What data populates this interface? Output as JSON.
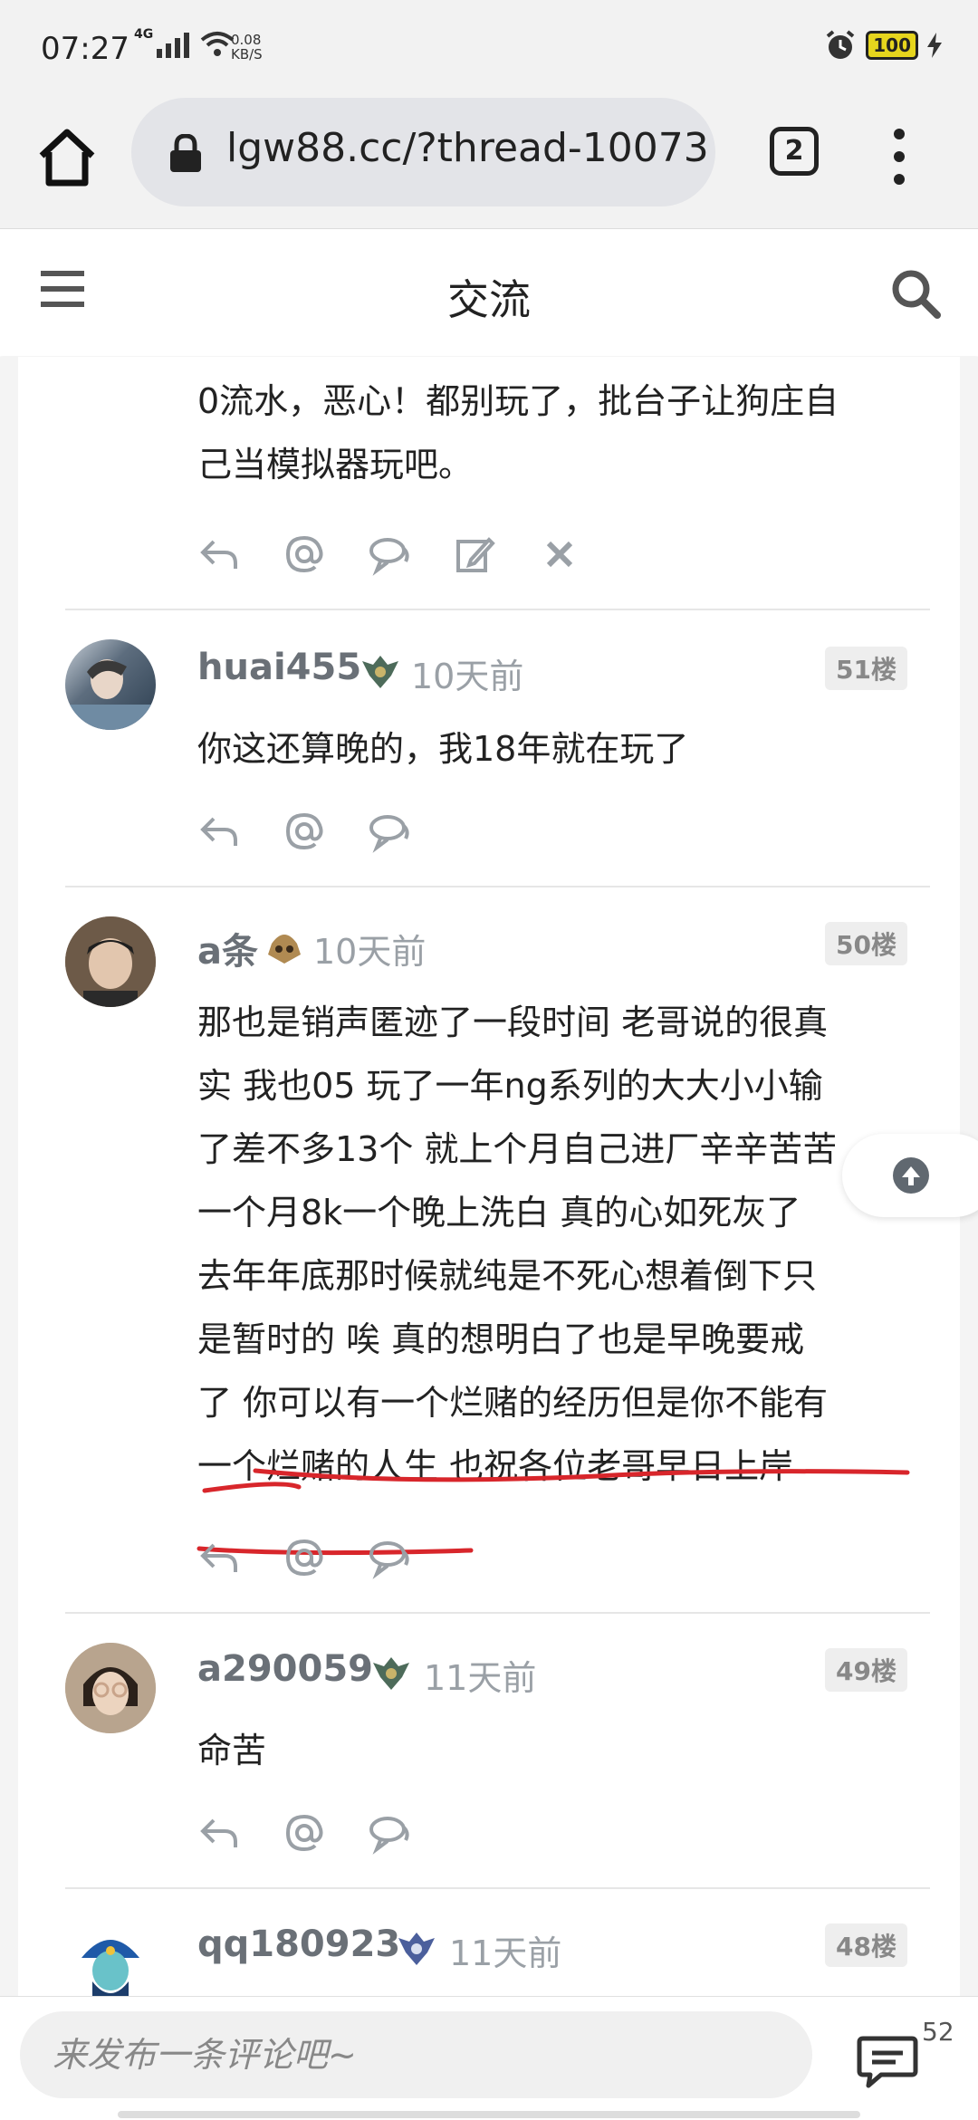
{
  "status_bar": {
    "time": "07:27",
    "network": "4G",
    "speed_value": "0.08",
    "speed_unit": "KB/S",
    "battery": "100"
  },
  "browser": {
    "url": "lgw88.cc/?thread-10073",
    "tab_count": "2"
  },
  "header": {
    "title": "交流"
  },
  "posts": [
    {
      "text_lines": [
        "0流水，恶心！都别玩了，批台子让狗庄自",
        "己当模拟器玩吧。"
      ]
    },
    {
      "username": "huai455",
      "time": "10天前",
      "floor": "51楼",
      "text": "你这还算晚的，我18年就在玩了"
    },
    {
      "username": "a条",
      "time": "10天前",
      "floor": "50楼",
      "text_lines": [
        "那也是销声匿迹了一段时间  老哥说的很真",
        "实  我也05  玩了一年ng系列的大大小小输",
        "了差不多13个  就上个月自己进厂辛辛苦苦",
        "一个月8k一个晚上洗白  真的心如死灰了",
        "去年年底那时候就纯是不死心想着倒下只",
        "是暂时的  唉  真的想明白了也是早晚要戒",
        "了  你可以有一个烂赌的经历但是你不能有",
        "一个烂赌的人生  也祝各位老哥早日上岸"
      ]
    },
    {
      "username": "a290059",
      "time": "11天前",
      "floor": "49楼",
      "text": "命苦"
    },
    {
      "username": "qq180923",
      "time": "11天前",
      "floor": "48楼"
    }
  ],
  "bottom": {
    "placeholder": "来发布一条评论吧~",
    "reply_count": "52"
  },
  "colors": {
    "accent_red": "#d8262b",
    "username": "#6a7077",
    "muted": "#9aa0a6"
  }
}
